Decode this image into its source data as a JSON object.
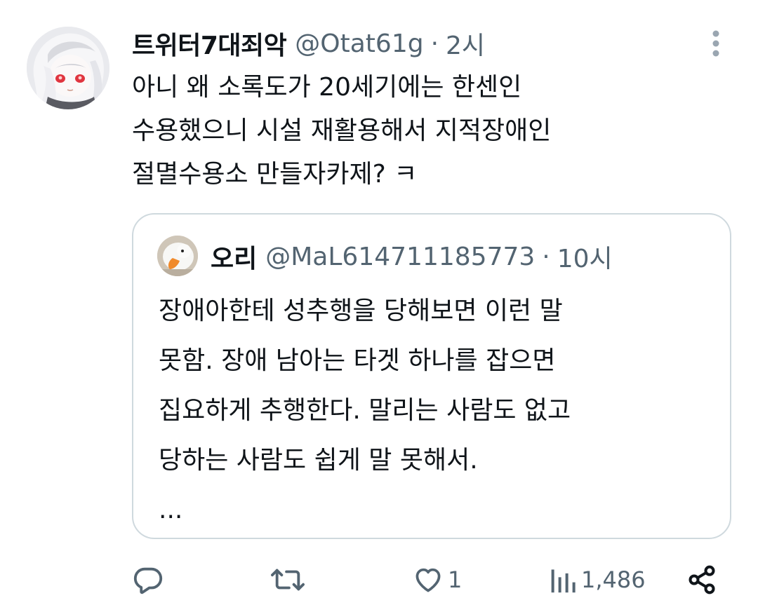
{
  "tweet": {
    "display_name": "트위터7대죄악",
    "handle": "@Otat61g",
    "separator": "·",
    "time": "2시",
    "text_lines": [
      "아니 왜 소록도가 20세기에는 한센인",
      "수용했으니 시설 재활용해서 지적장애인",
      "절멸수용소 만들자카제? ㅋ"
    ]
  },
  "quoted_tweet": {
    "display_name": "오리",
    "handle": "@MaL614711185773",
    "separator": "·",
    "time": "10시",
    "text_lines": [
      "장애아한테 성추행을 당해보면 이런 말",
      "못함. 장애 남아는 타겟 하나를 잡으면",
      "집요하게 추행한다. 말리는 사람도 없고",
      "당하는 사람도 쉽게 말 못해서.",
      "..."
    ]
  },
  "actions": {
    "reply": {
      "icon": "reply-icon",
      "count": ""
    },
    "retweet": {
      "icon": "retweet-icon",
      "count": ""
    },
    "like": {
      "icon": "heart-icon",
      "count": "1"
    },
    "views": {
      "icon": "views-chart-icon",
      "count": "1,486"
    },
    "share": {
      "icon": "share-icon"
    }
  },
  "colors": {
    "text_primary": "#0f1419",
    "text_secondary": "#536471",
    "border": "#cfd9de",
    "background": "#ffffff"
  }
}
